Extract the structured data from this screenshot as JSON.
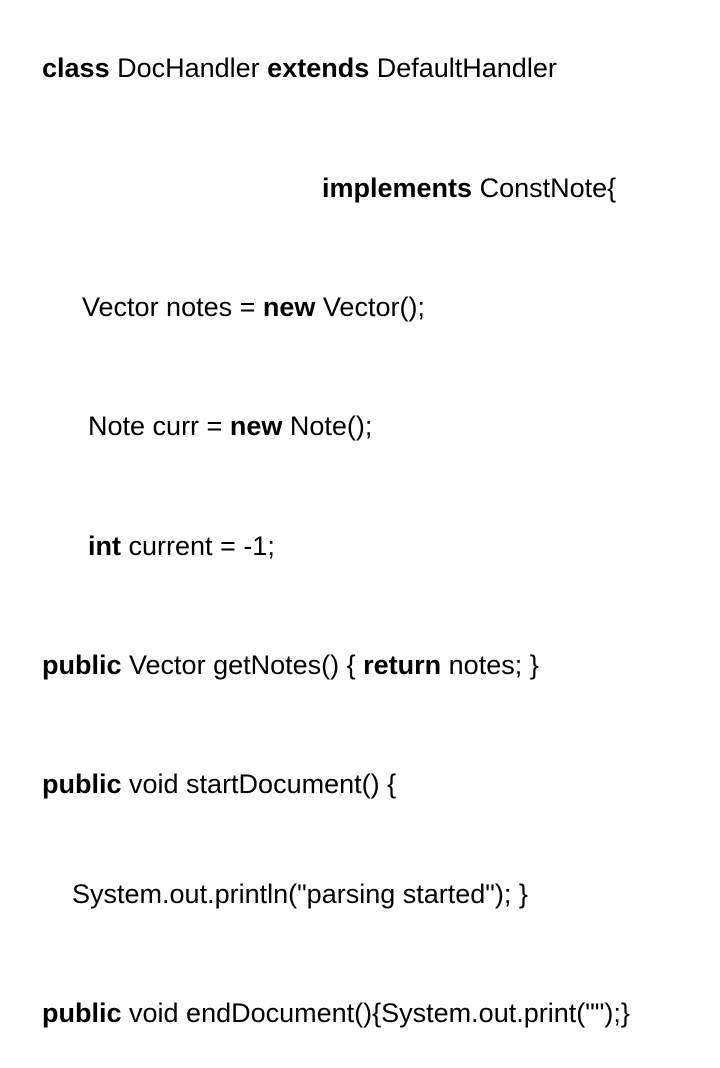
{
  "code": {
    "line1": {
      "s1": "class",
      "s2": " DocHandler ",
      "s3": "extends",
      "s4": " DefaultHandler"
    },
    "line2": {
      "s1": "implements",
      "s2": " ConstNote{"
    },
    "line3": {
      "s1": "Vector notes = ",
      "s2": "new",
      "s3": " Vector();"
    },
    "line4": {
      "s1": "Note curr = ",
      "s2": "new",
      "s3": " Note();"
    },
    "line5": {
      "s1": "int",
      "s2": " current = -1;"
    },
    "line6": {
      "s1": "public",
      "s2": " Vector getNotes() { ",
      "s3": "return",
      "s4": " notes; }"
    },
    "line7a": {
      "s1": "public",
      "s2": " void startDocument() {"
    },
    "line7b": {
      "s1": "System.out.println(\"parsing started\"); }"
    },
    "line8": {
      "s1": "public",
      "s2": " void endDocument(){System.out.print(\"\");}"
    }
  }
}
